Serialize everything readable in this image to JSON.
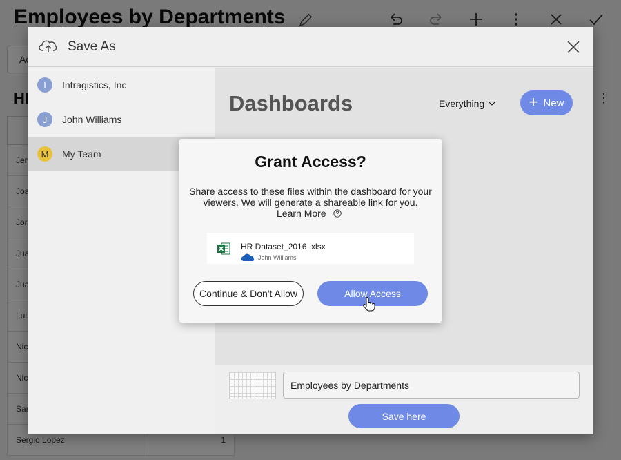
{
  "background": {
    "title": "Employees by Departments",
    "tab_label": "Ac",
    "widget_title": "HI",
    "rows": [
      {
        "name": "Jen",
        "value": ""
      },
      {
        "name": "Joa",
        "value": ""
      },
      {
        "name": "Jor",
        "value": ""
      },
      {
        "name": "Jua",
        "value": ""
      },
      {
        "name": "Jua",
        "value": ""
      },
      {
        "name": "Lui",
        "value": ""
      },
      {
        "name": "Nic",
        "value": ""
      },
      {
        "name": "Nic",
        "value": ""
      },
      {
        "name": "Sar",
        "value": ""
      },
      {
        "name": "Sergio Lopez",
        "value": "1"
      }
    ]
  },
  "save_dialog": {
    "title": "Save As",
    "icons": {
      "header": "cloud-upload-icon",
      "close": "close-icon"
    },
    "sidebar": [
      {
        "initial": "I",
        "label": "Infragistics, Inc",
        "color": "#8a9fd1"
      },
      {
        "initial": "J",
        "label": "John Williams",
        "color": "#8a9fd1"
      },
      {
        "initial": "M",
        "label": "My Team",
        "color": "#e8c23d",
        "selected": true
      }
    ],
    "main": {
      "title": "Dashboards",
      "filter_label": "Everything",
      "new_label": "New"
    },
    "footer": {
      "name_value": "Employees by Departments",
      "save_label": "Save here"
    }
  },
  "grant_dialog": {
    "title": "Grant Access?",
    "message": "Share access to these files within the dashboard for your viewers. We will generate a shareable link for you.",
    "learn_more": "Learn More",
    "file": {
      "name": "HR Dataset_2016 .xlsx",
      "owner": "John Williams",
      "icon": "excel-icon",
      "source_icon": "onedrive-icon"
    },
    "deny_label": "Continue & Don't Allow",
    "allow_label": "Allow Access"
  },
  "colors": {
    "accent": "#6e8ae6",
    "selected_item": "#d6d6d6",
    "excel_green": "#1f7244",
    "onedrive_blue": "#1c5fb8"
  }
}
